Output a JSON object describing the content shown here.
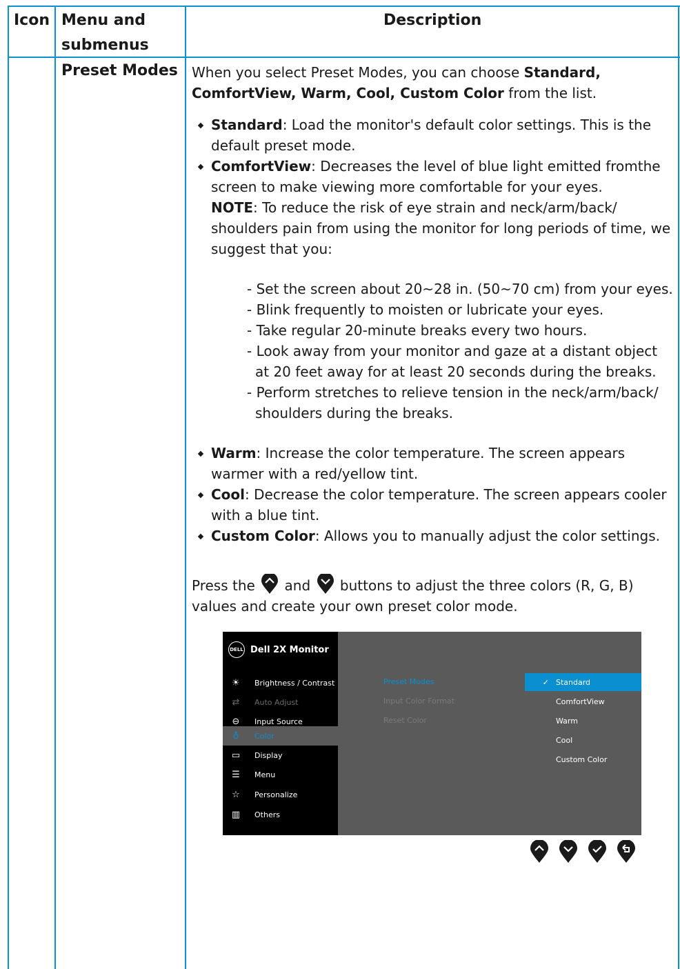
{
  "header": {
    "col1": "Icon",
    "col2_line1": "Menu and",
    "col2_line2": "submenus",
    "col3": "Description"
  },
  "row": {
    "submenu": "Preset Modes",
    "intro_plain": "When you select Preset Modes, you can choose ",
    "intro_bold": "Standard, ComfortView, Warm, Cool, Custom Color",
    "intro_end": " from the list.",
    "bullets": [
      {
        "term": "Standard",
        "text": ": Load the monitor's default color settings. This is the default preset mode."
      },
      {
        "term": "ComfortView",
        "text": ": Decreases the level of blue light emitted fromthe screen to make viewing more comfortable for your eyes."
      }
    ],
    "note_label": "NOTE",
    "note_text": ": To reduce the risk of eye strain and neck/arm/back/ shoulders pain from using the monitor for long periods of time, we suggest that you:",
    "tips": [
      "Set the screen about 20~28 in. (50~70 cm) from your eyes.",
      "Blink frequently to moisten or lubricate your eyes.",
      "Take regular 20-minute breaks every two hours.",
      "Look away from your monitor and gaze at a distant object at 20 feet away for at least 20 seconds during the breaks.",
      "Perform stretches to relieve tension in the neck/arm/back/ shoulders during the breaks."
    ],
    "bullets2": [
      {
        "term": "Warm",
        "text": ": Increase the color temperature. The screen appears warmer with a red/yellow tint."
      },
      {
        "term": "Cool",
        "text": ": Decrease the color temperature. The screen appears cooler with a blue tint."
      },
      {
        "term": "Custom Color",
        "text": ": Allows you to manually adjust the color settings."
      }
    ],
    "press_1": "Press the",
    "press_and": "and",
    "press_2": "buttons to adjust the three colors (R, G, B) values and create your own preset color mode."
  },
  "osd": {
    "logo": "DELL",
    "title": "Dell 2X Monitor",
    "menu": [
      {
        "icon": "brightness-icon",
        "label": "Brightness / Contrast",
        "state": "normal"
      },
      {
        "icon": "auto-adjust-icon",
        "label": "Auto Adjust",
        "state": "dim"
      },
      {
        "icon": "input-source-icon",
        "label": "Input Source",
        "state": "normal"
      },
      {
        "icon": "color-icon",
        "label": "Color",
        "state": "selected"
      },
      {
        "icon": "display-icon",
        "label": "Display",
        "state": "normal"
      },
      {
        "icon": "menu-icon",
        "label": "Menu",
        "state": "normal"
      },
      {
        "icon": "star-icon",
        "label": "Personalize",
        "state": "normal"
      },
      {
        "icon": "others-icon",
        "label": "Others",
        "state": "normal"
      }
    ],
    "submenu": [
      "Preset Modes",
      "Input Color Format",
      "Reset Color"
    ],
    "options": [
      "Standard",
      "ComfortView",
      "Warm",
      "Cool",
      "Custom Color"
    ],
    "selected_option": "Standard",
    "accent": "#0a8fd0"
  },
  "colors": {
    "rule": "#0a8fd0",
    "osd_bg": "#5a5a5a",
    "osd_left": "#000000"
  }
}
